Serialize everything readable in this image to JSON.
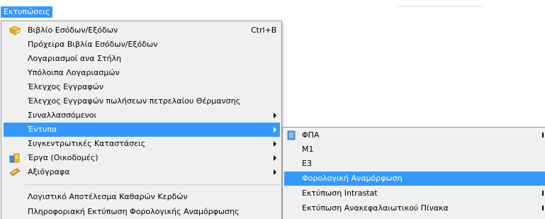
{
  "menubar": {
    "title": "Εκτυπώσεις"
  },
  "dropdown": {
    "items": [
      {
        "label": "Βιβλίο Εσόδων/Εξόδων",
        "shortcut": "Ctrl+B",
        "icon": "book-icon"
      },
      {
        "label": "Πρόχειρα Βιβλία Εσόδων/Εξόδων"
      },
      {
        "label": "Λογαριασμοί ανα Στήλη"
      },
      {
        "label": "Υπόλοιπα Λογαριασμών"
      },
      {
        "label": "Έλεγχος Εγγραφών"
      },
      {
        "label": "Έλεγχος Εγγραφών πωλήσεων πετρελαίου Θέρμανσης"
      },
      {
        "label": "Συναλλασσόμενοι"
      },
      {
        "label": "Έντυπα"
      },
      {
        "label": "Συγκεντρωτικές Καταστάσεις"
      },
      {
        "label": "Έργα (Οικοδομές)",
        "icon": "buildings-icon"
      },
      {
        "label": "Αξιόγραφα",
        "icon": "cheque-icon"
      },
      {
        "label": "Λογιστικό Αποτέλεσμα Καθαρών Κερδών"
      },
      {
        "label": "Πληροφοριακή Εκτύπωση Φορολογικής Αναμόρφωσης"
      }
    ]
  },
  "submenu": {
    "items": [
      {
        "label": "ΦΠΑ",
        "icon": "document-icon"
      },
      {
        "label": "Μ1"
      },
      {
        "label": "Ε3"
      },
      {
        "label": "Φορολογική Αναμόρφωση"
      },
      {
        "label": "Εκτύπωση Intrastat"
      },
      {
        "label": "Εκτύπωση Ανακεφαλαιωτικού Πίνακα"
      }
    ]
  },
  "colors": {
    "highlight": "#3399ff",
    "menu_background": "#f0f0f0",
    "menu_border": "#979797"
  }
}
